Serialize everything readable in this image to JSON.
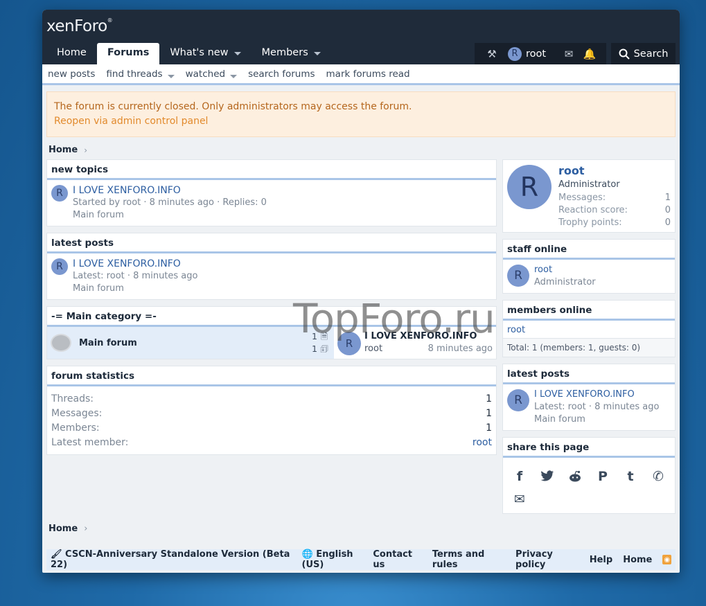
{
  "header": {
    "logo": "xenForo",
    "logo_mark": "®",
    "tabs": [
      {
        "label": "Home"
      },
      {
        "label": "Forums"
      },
      {
        "label": "What's new"
      },
      {
        "label": "Members"
      }
    ],
    "user_name": "root",
    "user_initial": "R",
    "search_label": "Search",
    "icons": [
      "wrench-screwdriver-icon",
      "envelope-icon",
      "bell-icon",
      "search-icon"
    ]
  },
  "subnav": [
    "new posts",
    "find threads",
    "watched",
    "search forums",
    "mark forums read"
  ],
  "notice": {
    "text": "The forum is currently closed. Only administrators may access the forum.",
    "link": "Reopen via admin control panel"
  },
  "breadcrumb": {
    "home": "Home"
  },
  "new_topics": {
    "title": "new topics",
    "item": {
      "initial": "R",
      "title": "I LOVE XENFORO.INFO",
      "meta": "Started by root · 8 minutes ago · Replies: 0",
      "forum": "Main forum"
    }
  },
  "latest_posts": {
    "title": "latest posts",
    "item": {
      "initial": "R",
      "title": "I LOVE XENFORO.INFO",
      "meta": "Latest: root · 8 minutes ago",
      "forum": "Main forum"
    }
  },
  "category": {
    "title": "-= Main category =-",
    "forum": {
      "name": "Main forum",
      "threads": "1",
      "messages": "1",
      "last_initial": "R",
      "last_title": "I LOVE XENFORO.INFO",
      "last_user": "root",
      "last_time": "8 minutes ago"
    }
  },
  "statistics": {
    "title": "forum statistics",
    "rows": [
      {
        "label": "Threads:",
        "value": "1"
      },
      {
        "label": "Messages:",
        "value": "1"
      },
      {
        "label": "Members:",
        "value": "1"
      },
      {
        "label": "Latest member:",
        "value": "root"
      }
    ]
  },
  "profile": {
    "initial": "R",
    "name": "root",
    "role": "Administrator",
    "stats": [
      {
        "label": "Messages:",
        "value": "1"
      },
      {
        "label": "Reaction score:",
        "value": "0"
      },
      {
        "label": "Trophy points:",
        "value": "0"
      }
    ]
  },
  "staff_online": {
    "title": "staff online",
    "initial": "R",
    "name": "root",
    "role": "Administrator"
  },
  "members_online": {
    "title": "members online",
    "member": "root",
    "total": "Total: 1 (members: 1, guests: 0)"
  },
  "side_latest": {
    "title": "latest posts",
    "initial": "R",
    "item_title": "I LOVE XENFORO.INFO",
    "meta": "Latest: root · 8 minutes ago",
    "forum": "Main forum"
  },
  "share": {
    "title": "share this page",
    "glyphs": [
      "f",
      "🐦",
      "👽",
      "P",
      "t",
      "✆",
      "✉"
    ]
  },
  "footer": {
    "style": "CSCN-Anniversary Standalone Version (Beta 22)",
    "language": "English (US)",
    "links": [
      "Contact us",
      "Terms and rules",
      "Privacy policy",
      "Help",
      "Home"
    ]
  },
  "watermark": "TopForo.ru"
}
